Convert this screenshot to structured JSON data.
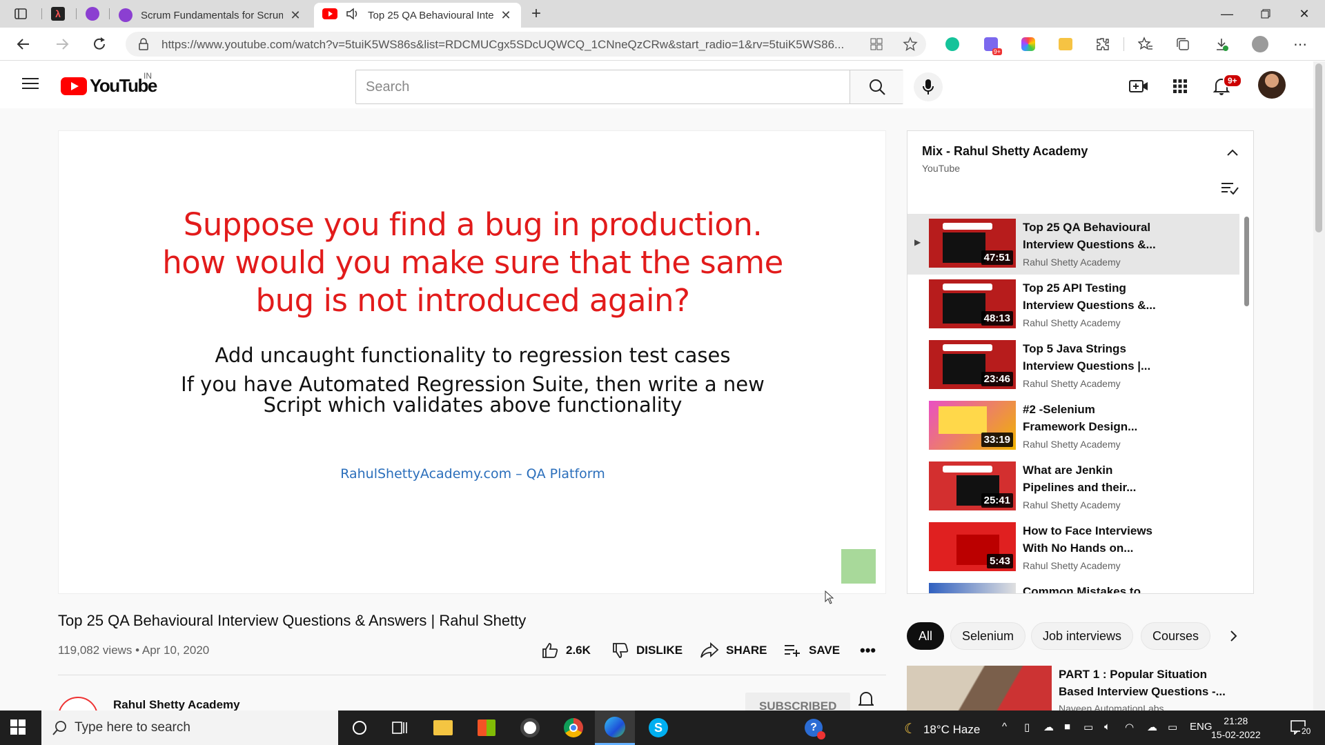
{
  "browser": {
    "tabs": [
      {
        "label": "Scrum Fundamentals for Scrum M",
        "favicon": "purple-circle"
      },
      {
        "label": "Top 25 QA Behavioural Inte",
        "favicon": "youtube",
        "audio": true
      }
    ],
    "url": "https://www.youtube.com/watch?v=5tuiK5WS86s&list=RDCMUCgx5SDcUQWCQ_1CNneQzCRw&start_radio=1&rv=5tuiK5WS86..."
  },
  "yt": {
    "logo_text": "YouTube",
    "region": "IN",
    "search_placeholder": "Search",
    "notif_count": "9+"
  },
  "video": {
    "slide": {
      "question": "Suppose you find a bug in production. how would you make sure that the same bug is not introduced again?",
      "answer1": "Add uncaught functionality to regression test cases",
      "answer2": "If you have Automated Regression Suite, then write a new Script which validates above functionality",
      "footer": "RahulShettyAcademy.com – QA Platform"
    },
    "title": "Top 25 QA Behavioural Interview Questions & Answers | Rahul Shetty",
    "meta": "119,082 views • Apr 10, 2020",
    "likes": "2.6K",
    "dislike_label": "DISLIKE",
    "share_label": "SHARE",
    "save_label": "SAVE",
    "channel": "Rahul Shetty Academy",
    "subscribe_label": "SUBSCRIBED"
  },
  "playlist": {
    "title": "Mix - Rahul Shetty Academy",
    "subtitle": "YouTube",
    "items": [
      {
        "title": "Top 25 QA Behavioural Interview Questions &...",
        "channel": "Rahul Shetty Academy",
        "duration": "47:51",
        "current": true
      },
      {
        "title": "Top 25 API Testing Interview Questions &...",
        "channel": "Rahul Shetty Academy",
        "duration": "48:13"
      },
      {
        "title": "Top 5 Java Strings Interview Questions |...",
        "channel": "Rahul Shetty Academy",
        "duration": "23:46"
      },
      {
        "title": "#2 -Selenium Framework Design...",
        "channel": "Rahul Shetty Academy",
        "duration": "33:19"
      },
      {
        "title": "What are Jenkin Pipelines and their...",
        "channel": "Rahul Shetty Academy",
        "duration": "25:41"
      },
      {
        "title": "How to Face Interviews With No Hands on...",
        "channel": "Rahul Shetty Academy",
        "duration": "5:43"
      },
      {
        "title": "Common Mistakes to",
        "channel": "",
        "duration": ""
      }
    ]
  },
  "chips": [
    "All",
    "Selenium",
    "Job interviews",
    "Courses"
  ],
  "recommendation": {
    "title": "PART 1 : Popular Situation Based Interview Questions -...",
    "channel": "Naveen AutomationLabs"
  },
  "taskbar": {
    "search_placeholder": "Type here to search",
    "weather": "18°C  Haze",
    "lang": "ENG",
    "time": "21:28",
    "date": "15-02-2022",
    "notif_count": "20"
  }
}
